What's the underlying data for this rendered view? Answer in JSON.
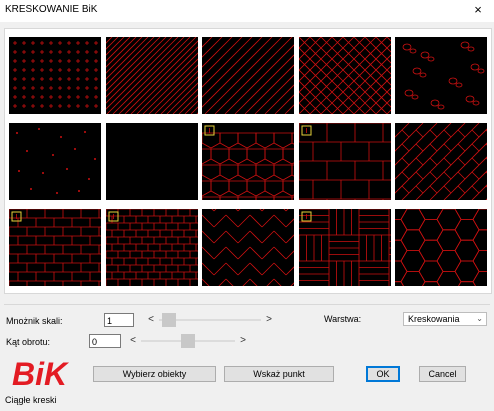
{
  "window": {
    "title": "KRESKOWANIE BiK",
    "close_glyph": "×",
    "close_icon": "close-icon"
  },
  "pattern_gallery": {
    "line_color": "#cc1111",
    "marker_color": "#e6d23a",
    "patterns": [
      {
        "name": "cross-grid",
        "highlighted": false
      },
      {
        "name": "diagonal-lines-dense",
        "highlighted": false
      },
      {
        "name": "diagonal-lines-wide",
        "highlighted": false
      },
      {
        "name": "diamond-crosshatch",
        "highlighted": false
      },
      {
        "name": "gravel",
        "highlighted": false
      },
      {
        "name": "dots-sparse",
        "highlighted": false
      },
      {
        "name": "solid-black",
        "highlighted": false
      },
      {
        "name": "roof-tiles",
        "highlighted": true
      },
      {
        "name": "stone-blocks",
        "highlighted": true
      },
      {
        "name": "herringbone-diagonal",
        "highlighted": false
      },
      {
        "name": "brick-wall",
        "highlighted": true
      },
      {
        "name": "brick-wall-small",
        "highlighted": true
      },
      {
        "name": "zigzag-parquet",
        "highlighted": false
      },
      {
        "name": "basket-weave",
        "highlighted": true
      },
      {
        "name": "hexagon",
        "highlighted": false
      }
    ]
  },
  "controls": {
    "scale_label": "Mnożnik skali:",
    "scale_value": "1",
    "scale_slider_level": 0.03,
    "angle_label": "Kąt obrotu:",
    "angle_value": "0",
    "angle_slider_level": 0.5,
    "slider_left_arrow": "<",
    "slider_right_arrow": ">",
    "layer_label": "Warstwa:",
    "layer_value": "Kreskowania",
    "dropdown_icon": "chevron-down-icon"
  },
  "buttons": {
    "select_objects": "Wybierz obiekty",
    "pick_point": "Wskaż punkt",
    "ok": "OK",
    "cancel": "Cancel"
  },
  "logo": {
    "text": "BiK",
    "color": "#e31b23"
  },
  "status": {
    "text": "Ciągłe kreski"
  }
}
